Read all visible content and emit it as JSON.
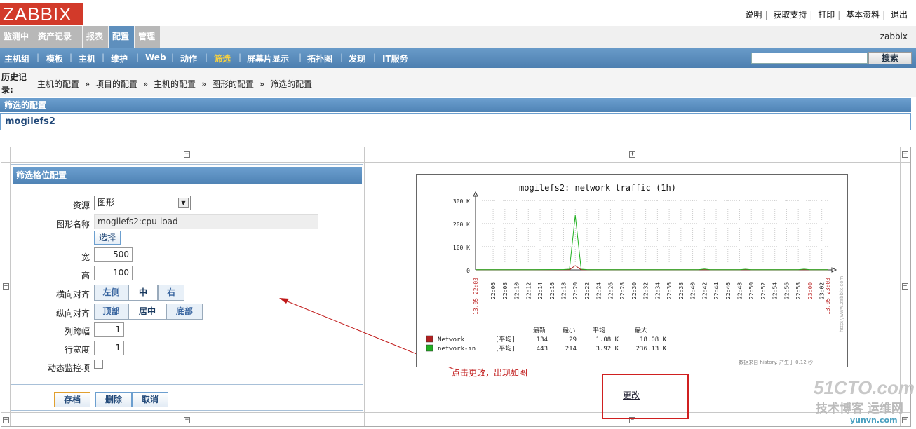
{
  "app": {
    "logo": "ZABBIX"
  },
  "top_links": [
    "说明",
    "获取支持",
    "打印",
    "基本资料",
    "退出"
  ],
  "main_menu": {
    "tabs": [
      {
        "label": "监测中"
      },
      {
        "label": "资产记录"
      },
      {
        "label": "报表"
      },
      {
        "label": "配置",
        "active": true
      },
      {
        "label": "管理"
      }
    ],
    "user": "zabbix"
  },
  "sub_menu": {
    "items": [
      "主机组",
      "模板",
      "主机",
      "维护",
      "Web",
      "动作",
      "筛选",
      "屏幕片显示",
      "拓扑图",
      "发现",
      "IT服务"
    ],
    "selected": "筛选",
    "search_button": "搜索"
  },
  "history": {
    "label": "历史记录:",
    "crumbs": [
      "主机的配置",
      "项目的配置",
      "主机的配置",
      "图形的配置",
      "筛选的配置"
    ],
    "separator": "»"
  },
  "section_title": "筛选的配置",
  "screen_name": "mogilefs2",
  "form": {
    "title": "筛选格位配置",
    "resource_label": "资源",
    "resource_value": "图形",
    "graph_name_label": "图形名称",
    "graph_name_value": "mogilefs2:cpu-load",
    "select_button": "选择",
    "width_label": "宽",
    "width_value": "500",
    "height_label": "高",
    "height_value": "100",
    "halign_label": "横向对齐",
    "halign_options": [
      "左侧",
      "中",
      "右"
    ],
    "halign_selected": "中",
    "valign_label": "纵向对齐",
    "valign_options": [
      "顶部",
      "居中",
      "底部"
    ],
    "valign_selected": "居中",
    "colspan_label": "列跨幅",
    "colspan_value": "1",
    "rowspan_label": "行宽度",
    "rowspan_value": "1",
    "dynamic_label": "动态监控项",
    "dynamic_checked": false,
    "save_button": "存档",
    "delete_button": "删除",
    "cancel_button": "取消"
  },
  "graph": {
    "change_link": "更改",
    "annotation": "点击更改，出现如图",
    "stat_headers": [
      "最新",
      "最小",
      "平均",
      "最大"
    ],
    "footer": "数据来自 history. 产生于 0.12 秒",
    "sidebar": "http://www.zabbix.com"
  },
  "chart_data": {
    "type": "line",
    "title": "mogilefs2: network traffic (1h)",
    "ylim": [
      0,
      300000
    ],
    "y_ticks": [
      "0",
      "100 K",
      "200 K",
      "300 K"
    ],
    "x_ticks": [
      "22:06",
      "22:08",
      "22:10",
      "22:12",
      "22:14",
      "22:16",
      "22:18",
      "22:20",
      "22:22",
      "22:24",
      "22:26",
      "22:28",
      "22:30",
      "22:32",
      "22:34",
      "22:36",
      "22:38",
      "22:40",
      "22:42",
      "22:44",
      "22:46",
      "22:48",
      "22:50",
      "22:52",
      "22:54",
      "22:56",
      "22:58",
      "23:00",
      "23:02"
    ],
    "x_start_label": "13.05 22:03",
    "x_end_label": "13.05 23:03",
    "highlight_ticks": [
      "23:00"
    ],
    "grid": true,
    "series": [
      {
        "name": "Network",
        "agg": "[平均]",
        "color": "#b02020",
        "last": "134",
        "min": "29",
        "avg": "1.08 K",
        "max": "18.08 K",
        "x": [
          0,
          8,
          15,
          16,
          17,
          18,
          19,
          30,
          50,
          60
        ],
        "y": [
          500,
          800,
          600,
          900,
          18080,
          900,
          700,
          600,
          800,
          600
        ]
      },
      {
        "name": "network-in",
        "agg": "[平均]",
        "color": "#20b020",
        "last": "443",
        "min": "214",
        "avg": "3.92 K",
        "max": "236.13 K",
        "x": [
          0,
          10,
          15,
          16,
          17,
          18,
          19,
          20,
          30,
          38,
          39,
          40,
          45,
          46,
          47,
          55,
          56,
          57,
          60
        ],
        "y": [
          1000,
          900,
          1500,
          3000,
          236130,
          3000,
          1200,
          900,
          800,
          700,
          3500,
          800,
          900,
          3000,
          900,
          800,
          3200,
          800,
          700
        ]
      }
    ]
  }
}
